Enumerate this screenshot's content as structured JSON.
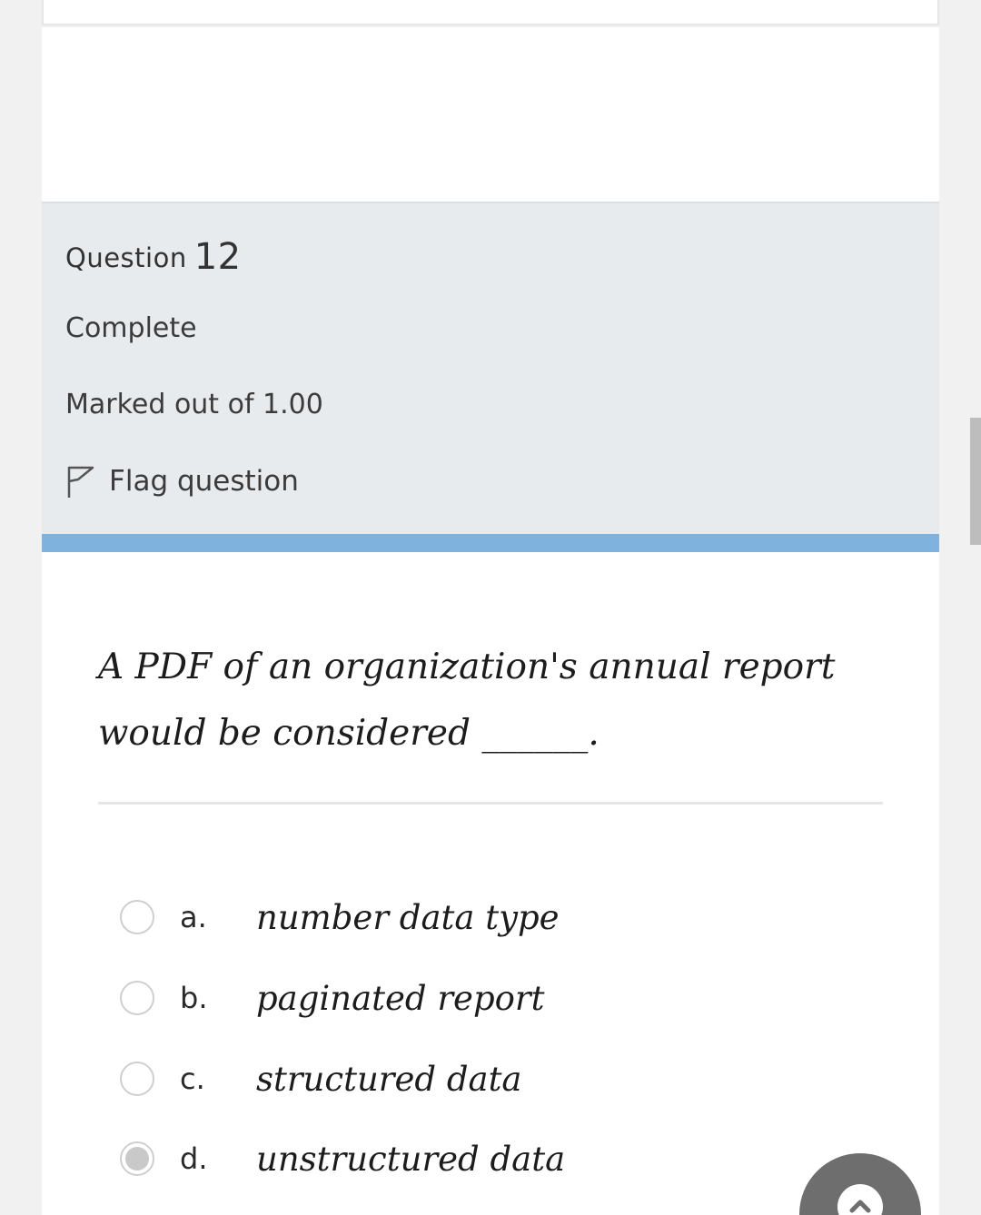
{
  "question": {
    "label": "Question",
    "number": "12",
    "state": "Complete",
    "grade": "Marked out of 1.00",
    "flag_label": "Flag question",
    "text_line1": "A PDF of an organization's annual report",
    "text_line2": "would be considered ______."
  },
  "options": [
    {
      "letter": "a.",
      "text": "number data type",
      "selected": false
    },
    {
      "letter": "b.",
      "text": "paginated report",
      "selected": false
    },
    {
      "letter": "c.",
      "text": "structured data",
      "selected": false
    },
    {
      "letter": "d.",
      "text": "unstructured data",
      "selected": true
    }
  ],
  "icons": {
    "flag": "flag-outline-icon",
    "scroll_top": "chevron-up-icon"
  },
  "colors": {
    "info_panel_bg": "#e8ebee",
    "accent_bar": "#7fb3de",
    "fab_bg": "#6e6e6e"
  }
}
